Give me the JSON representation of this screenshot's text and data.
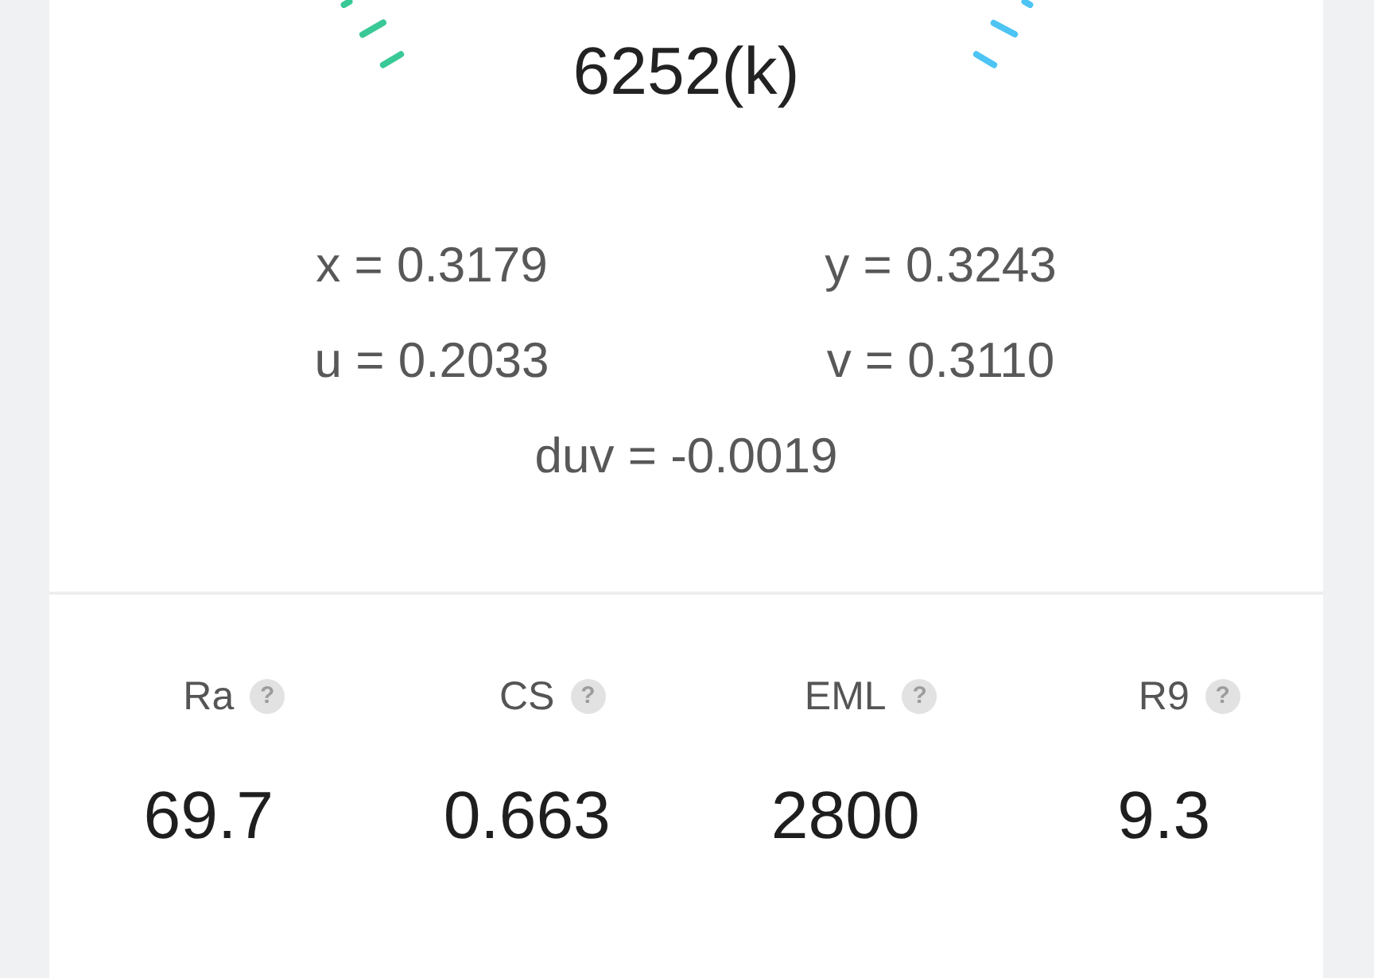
{
  "color_temperature": {
    "value": "6252(k)"
  },
  "chromaticity": [
    {
      "text": "x = 0.3179"
    },
    {
      "text": "y = 0.3243"
    },
    {
      "text": "u = 0.2033"
    },
    {
      "text": "v = 0.3110"
    }
  ],
  "duv": "duv = -0.0019",
  "metrics": [
    {
      "label": "Ra",
      "help": "?",
      "value": "69.7"
    },
    {
      "label": "CS",
      "help": "?",
      "value": "0.663"
    },
    {
      "label": "EML",
      "help": "?",
      "value": "2800"
    },
    {
      "label": "R9",
      "help": "?",
      "value": "9.3"
    }
  ]
}
